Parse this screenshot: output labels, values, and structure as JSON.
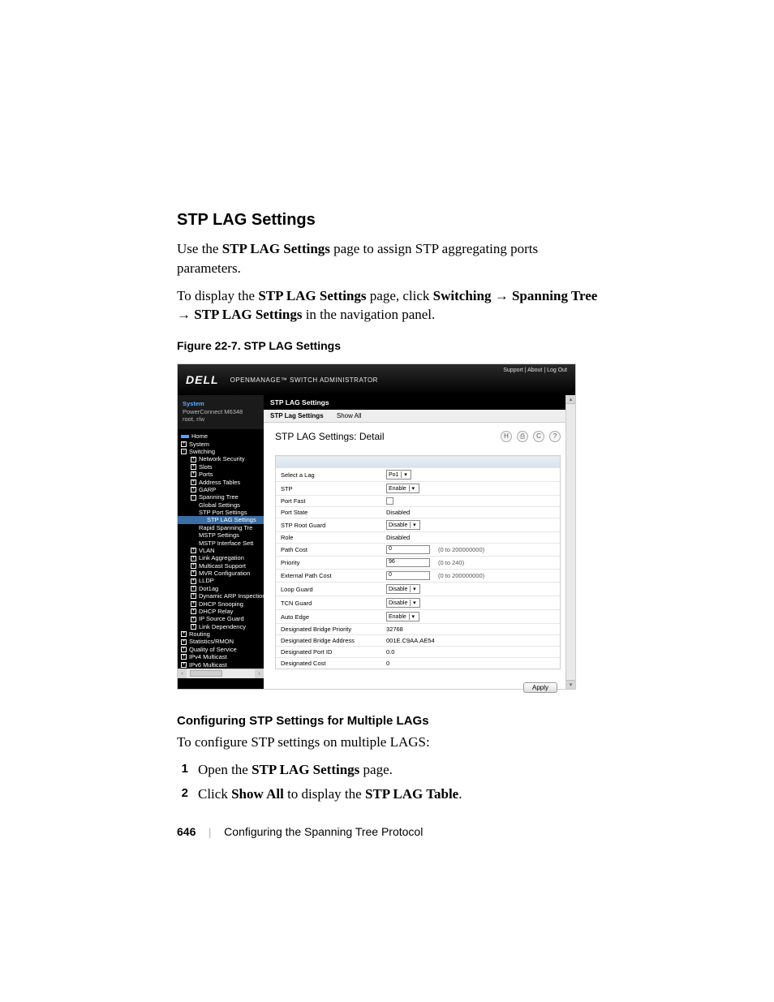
{
  "section_title": "STP LAG Settings",
  "para1_pre": "Use the ",
  "para1_bold": "STP LAG Settings",
  "para1_post": " page to assign STP aggregating ports parameters.",
  "para2_pre": "To display the ",
  "para2_b1": "STP LAG Settings",
  "para2_mid": " page, click ",
  "para2_b2": "Switching",
  "arrow": " → ",
  "para2_b3": "Spanning Tree",
  "para2_b4": "STP LAG Settings",
  "para2_post": " in the navigation panel.",
  "figure_caption": "Figure 22-7.    STP LAG Settings",
  "banner": {
    "logo": "DELL",
    "title": "OPENMANAGE™ SWITCH ADMINISTRATOR",
    "links": "Support | About | Log Out"
  },
  "sysbox": {
    "l1": "System",
    "l2": "PowerConnect M6348",
    "l3": "root, r/w"
  },
  "tree": {
    "home": "Home",
    "system": "System",
    "switching": "Switching",
    "netsec": "Network Security",
    "slots": "Slots",
    "ports": "Ports",
    "addr": "Address Tables",
    "garp": "GARP",
    "sptree": "Spanning Tree",
    "global": "Global Settings",
    "stpport": "STP Port Settings",
    "stplag": "STP LAG Settings",
    "rapid": "Rapid Spanning Tre",
    "mstpset": "MSTP Settings",
    "mstpint": "MSTP Interface Sett",
    "vlan": "VLAN",
    "linkagg": "Link Aggregation",
    "mcast": "Multicast Support",
    "mvr": "MVR Configuration",
    "lldp": "LLDP",
    "dot1ag": "Dot1ag",
    "dynarp": "Dynamic ARP Inspection",
    "dhcpsn": "DHCP Snooping",
    "dhcprl": "DHCP Relay",
    "ipsrc": "IP Source Guard",
    "linkdep": "Link Dependency",
    "routing": "Routing",
    "stats": "Statistics/RMON",
    "qos": "Quality of Service",
    "ipv4m": "IPv4 Multicast",
    "ipv6m": "IPv6 Multicast"
  },
  "blackbar": "STP LAG Settings",
  "subtabs": {
    "a": "STP Lag Settings",
    "b": "Show All"
  },
  "detail_title": "STP LAG Settings: Detail",
  "iconTips": {
    "save": "H",
    "print": "⎙",
    "refresh": "C",
    "help": "?"
  },
  "form": {
    "rows": [
      {
        "label": "Select a Lag",
        "type": "select",
        "value": "Po1"
      },
      {
        "label": "STP",
        "type": "select",
        "value": "Enable"
      },
      {
        "label": "Port Fast",
        "type": "checkbox"
      },
      {
        "label": "Port State",
        "type": "text",
        "value": "Disabled"
      },
      {
        "label": "STP Root Guard",
        "type": "select",
        "value": "Disable"
      },
      {
        "label": "Role",
        "type": "text",
        "value": "Disabled"
      },
      {
        "label": "Path Cost",
        "type": "input",
        "value": "0",
        "hint": "(0 to 200000000)"
      },
      {
        "label": "Priority",
        "type": "input",
        "value": "96",
        "hint": "(0 to 240)"
      },
      {
        "label": "External Path Cost",
        "type": "input",
        "value": "0",
        "hint": "(0 to 200000000)"
      },
      {
        "label": "Loop Guard",
        "type": "select",
        "value": "Disable"
      },
      {
        "label": "TCN Guard",
        "type": "select",
        "value": "Disable"
      },
      {
        "label": "Auto Edge",
        "type": "select",
        "value": "Enable"
      },
      {
        "label": "Designated Bridge Priority",
        "type": "text",
        "value": "32768"
      },
      {
        "label": "Designated Bridge Address",
        "type": "text",
        "value": "001E.C9AA.AE54"
      },
      {
        "label": "Designated Port ID",
        "type": "text",
        "value": "0.0"
      },
      {
        "label": "Designated Cost",
        "type": "text",
        "value": "0"
      }
    ],
    "apply": "Apply"
  },
  "subhead": "Configuring STP Settings for Multiple LAGs",
  "subintro": "To configure STP settings on multiple LAGS:",
  "steps": [
    {
      "n": "1",
      "pre": "Open the ",
      "b": "STP LAG Settings",
      "post": " page."
    },
    {
      "n": "2",
      "pre": "Click ",
      "b": "Show All",
      "mid": " to display the ",
      "b2": "STP LAG Table",
      "post": "."
    }
  ],
  "footer": {
    "page": "646",
    "chapter": "Configuring the Spanning Tree Protocol"
  }
}
